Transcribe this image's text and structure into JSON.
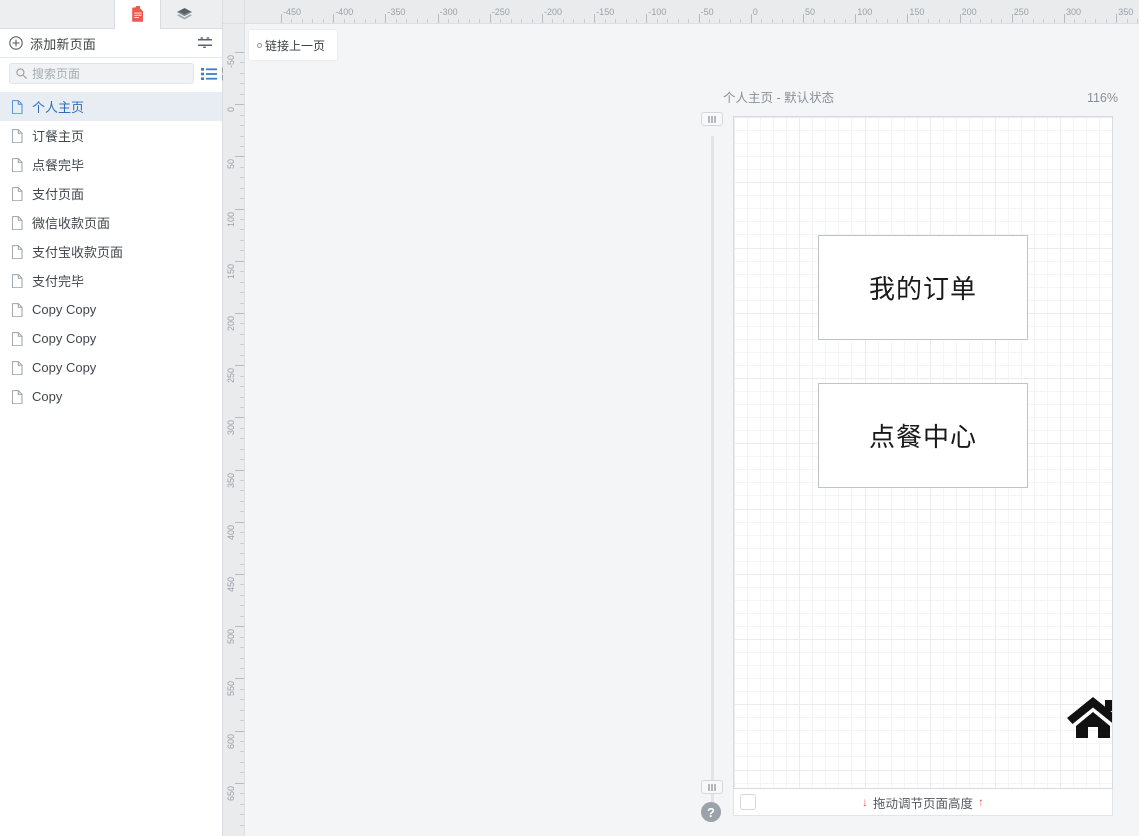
{
  "sidebar": {
    "tabs": [
      {
        "name": "pages-tab",
        "icon": "document-icon",
        "active": true
      },
      {
        "name": "layers-tab",
        "icon": "layers-icon",
        "active": false
      }
    ],
    "add_page": {
      "label": "添加新页面",
      "icon": "plus-circle-icon",
      "sort_icon": "sort-icon"
    },
    "search": {
      "placeholder": "搜索页面",
      "value": "",
      "icon": "search-icon"
    },
    "view_modes": [
      {
        "name": "list-view",
        "icon": "list-icon",
        "active": true
      },
      {
        "name": "grid-view",
        "icon": "grid-icon",
        "active": false
      }
    ],
    "pages": [
      {
        "label": "个人主页",
        "selected": true
      },
      {
        "label": "订餐主页",
        "selected": false
      },
      {
        "label": "点餐完毕",
        "selected": false
      },
      {
        "label": "支付页面",
        "selected": false
      },
      {
        "label": "微信收款页面",
        "selected": false
      },
      {
        "label": "支付宝收款页面",
        "selected": false
      },
      {
        "label": "支付完毕",
        "selected": false
      },
      {
        "label": "Copy Copy",
        "selected": false
      },
      {
        "label": "Copy Copy",
        "selected": false
      },
      {
        "label": "Copy Copy",
        "selected": false
      },
      {
        "label": "Copy",
        "selected": false
      }
    ]
  },
  "rulers": {
    "horizontal": {
      "labels": [
        "-450",
        "-400",
        "-350",
        "-300",
        "-250",
        "-200",
        "-150",
        "-100",
        "-50",
        "0",
        "50",
        "100",
        "150",
        "200",
        "250",
        "300",
        "350"
      ],
      "step": 50,
      "unit": "px"
    },
    "vertical": {
      "labels": [
        "-50",
        "0",
        "50",
        "100",
        "150",
        "200",
        "250",
        "300",
        "350",
        "400",
        "450",
        "500",
        "550",
        "600",
        "650"
      ],
      "step": 50,
      "unit": "px"
    }
  },
  "canvas": {
    "link_tooltip": {
      "label": "链接上一页",
      "icon": "circle-dot-icon"
    },
    "page_title": "个人主页 - 默认状态",
    "zoom_level": "116%",
    "widgets": [
      {
        "type": "button-box",
        "label": "我的订单",
        "name": "widget-my-orders"
      },
      {
        "type": "button-box",
        "label": "点餐中心",
        "name": "widget-order-center"
      },
      {
        "type": "icon",
        "label": "",
        "icon": "home-icon",
        "name": "widget-home-icon"
      },
      {
        "type": "icon",
        "label": "",
        "icon": "user-icon",
        "name": "widget-user-icon"
      }
    ],
    "bottom_bar": {
      "label": "拖动调节页面高度",
      "arrow_down": "↓",
      "arrow_up": "↑",
      "arrow_color": "#d4605a"
    },
    "help_label": "?"
  },
  "colors": {
    "accent_red": "#e8564a",
    "accent_blue": "#2c6fb8",
    "selected_bg": "#e8edf3",
    "panel_border": "#d9dde2",
    "ruler_bg": "#e9ebed",
    "workspace_bg": "#f4f5f6"
  }
}
